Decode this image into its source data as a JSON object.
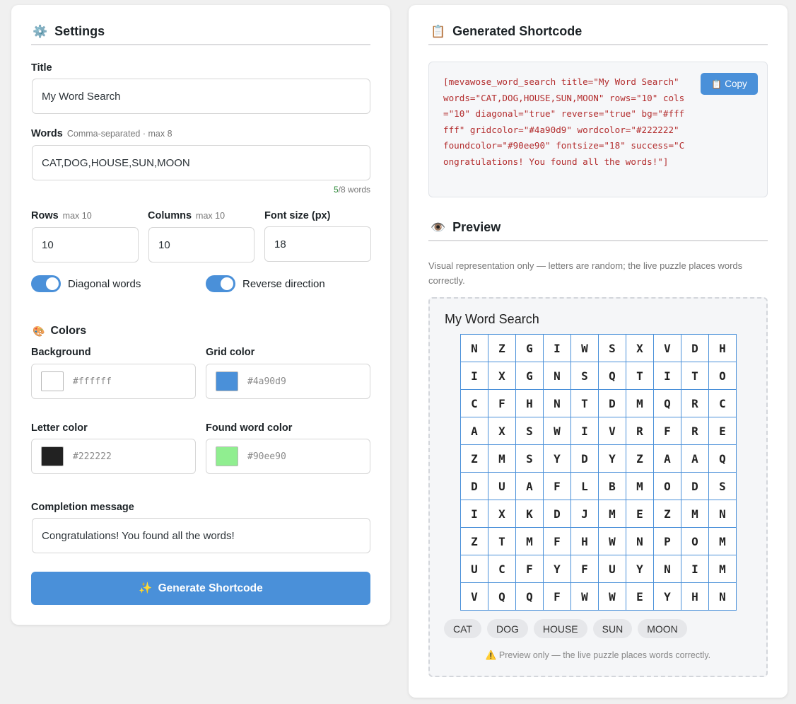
{
  "settings": {
    "icon": "gear-icon",
    "heading": "Settings",
    "title_label": "Title",
    "title_value": "My Word Search",
    "words_label": "Words",
    "words_hint": "Comma-separated · max 8",
    "words_value": "CAT,DOG,HOUSE,SUN,MOON",
    "words_count": "5",
    "words_count_suffix": "/8 words",
    "rows_label": "Rows",
    "rows_hint": "max 10",
    "rows_value": "10",
    "cols_label": "Columns",
    "cols_hint": "max 10",
    "cols_value": "10",
    "fontsize_label": "Font size (px)",
    "fontsize_value": "18",
    "diagonal_label": "Diagonal words",
    "diagonal_on": true,
    "reverse_label": "Reverse direction",
    "reverse_on": true,
    "colors_icon": "palette-icon",
    "colors_heading": "Colors",
    "bg_label": "Background",
    "bg_value": "#ffffff",
    "grid_label": "Grid color",
    "grid_value": "#4a90d9",
    "letter_label": "Letter color",
    "letter_value": "#222222",
    "found_label": "Found word color",
    "found_value": "#90ee90",
    "completion_label": "Completion message",
    "completion_value": "Congratulations! You found all the words!",
    "generate_icon": "sparkles-icon",
    "generate_label": "Generate Shortcode"
  },
  "shortcode": {
    "icon": "clipboard-icon",
    "heading": "Generated Shortcode",
    "code": "[mevawose_word_search title=\"My Word Search\" words=\"CAT,DOG,HOUSE,SUN,MOON\" rows=\"10\" cols=\"10\" diagonal=\"true\" reverse=\"true\" bg=\"#ffffff\" gridcolor=\"#4a90d9\" wordcolor=\"#222222\" foundcolor=\"#90ee90\" fontsize=\"18\" success=\"Congratulations! You found all the words!\"]",
    "copy_icon": "clipboard-icon",
    "copy_label": "Copy"
  },
  "preview": {
    "icon": "eye-icon",
    "heading": "Preview",
    "note": "Visual representation only — letters are random; the live puzzle places words correctly.",
    "puzzle_title": "My Word Search",
    "grid": [
      [
        "N",
        "Z",
        "G",
        "I",
        "W",
        "S",
        "X",
        "V",
        "D",
        "H"
      ],
      [
        "I",
        "X",
        "G",
        "N",
        "S",
        "Q",
        "T",
        "I",
        "T",
        "O"
      ],
      [
        "C",
        "F",
        "H",
        "N",
        "T",
        "D",
        "M",
        "Q",
        "R",
        "C"
      ],
      [
        "A",
        "X",
        "S",
        "W",
        "I",
        "V",
        "R",
        "F",
        "R",
        "E"
      ],
      [
        "Z",
        "M",
        "S",
        "Y",
        "D",
        "Y",
        "Z",
        "A",
        "A",
        "Q"
      ],
      [
        "D",
        "U",
        "A",
        "F",
        "L",
        "B",
        "M",
        "O",
        "D",
        "S"
      ],
      [
        "I",
        "X",
        "K",
        "D",
        "J",
        "M",
        "E",
        "Z",
        "M",
        "N"
      ],
      [
        "Z",
        "T",
        "M",
        "F",
        "H",
        "W",
        "N",
        "P",
        "O",
        "M"
      ],
      [
        "U",
        "C",
        "F",
        "Y",
        "F",
        "U",
        "Y",
        "N",
        "I",
        "M"
      ],
      [
        "V",
        "Q",
        "Q",
        "F",
        "W",
        "W",
        "E",
        "Y",
        "H",
        "N"
      ]
    ],
    "words": [
      "CAT",
      "DOG",
      "HOUSE",
      "SUN",
      "MOON"
    ],
    "warning_icon": "warning-icon",
    "warning": "Preview only — the live puzzle places words correctly."
  },
  "colors": {
    "accent": "#4a90d9",
    "code_text": "#b32d2e",
    "bg_swatch": "#ffffff",
    "grid_swatch": "#4a90d9",
    "letter_swatch": "#222222",
    "found_swatch": "#90ee90"
  }
}
